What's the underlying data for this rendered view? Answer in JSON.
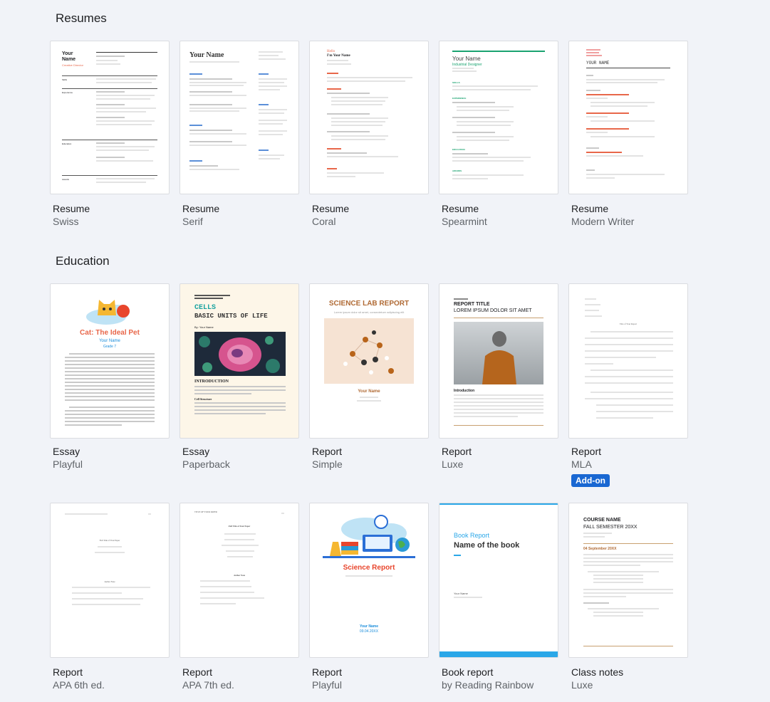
{
  "sections": {
    "resumes": "Resumes",
    "education": "Education"
  },
  "resumes": [
    {
      "title": "Resume",
      "subtitle": "Swiss"
    },
    {
      "title": "Resume",
      "subtitle": "Serif"
    },
    {
      "title": "Resume",
      "subtitle": "Coral"
    },
    {
      "title": "Resume",
      "subtitle": "Spearmint"
    },
    {
      "title": "Resume",
      "subtitle": "Modern Writer"
    }
  ],
  "education": [
    {
      "title": "Essay",
      "subtitle": "Playful"
    },
    {
      "title": "Essay",
      "subtitle": "Paperback"
    },
    {
      "title": "Report",
      "subtitle": "Simple"
    },
    {
      "title": "Report",
      "subtitle": "Luxe"
    },
    {
      "title": "Report",
      "subtitle": "MLA",
      "badge": "Add-on"
    },
    {
      "title": "Report",
      "subtitle": "APA 6th ed."
    },
    {
      "title": "Report",
      "subtitle": "APA 7th ed."
    },
    {
      "title": "Report",
      "subtitle": "Playful"
    },
    {
      "title": "Book report",
      "subtitle": "by Reading Rainbow"
    },
    {
      "title": "Class notes",
      "subtitle": "Luxe"
    }
  ],
  "previews": {
    "swiss": {
      "name1": "Your",
      "name2": "Name",
      "role": "Creative Director",
      "skills": "Skills",
      "experience": "Experience",
      "education": "Education",
      "awards": "Awards"
    },
    "serif": {
      "name": "Your Name"
    },
    "coral": {
      "hello": "Hello",
      "name": "I'm Your Name"
    },
    "spearmint": {
      "name": "Your Name",
      "role": "Industrial Designer",
      "skills": "SKILLS",
      "experience": "EXPERIENCE",
      "education": "EDUCATION",
      "awards": "AWARDS"
    },
    "modern": {
      "name": "YOUR NAME"
    },
    "playful_essay": {
      "title": "Cat: The Ideal Pet",
      "name": "Your Name",
      "grade": "Grade 7"
    },
    "paperback": {
      "title1": "CELLS",
      "title2": "BASIC UNITS OF LIFE",
      "by": "By: Your Name",
      "intro": "INTRODUCTION",
      "sub": "Cell Structure"
    },
    "simple": {
      "title": "SCIENCE LAB REPORT",
      "sub": "Lorem ipsum dolor sit amet, consectetuer adipiscing elit",
      "name": "Your Name"
    },
    "luxe": {
      "title1": "REPORT TITLE",
      "title2": "LOREM IPSUM DOLOR SIT AMET",
      "intro": "Introduction"
    },
    "mla": {
      "title": "Title of Your Report"
    },
    "apa6": {
      "title": "Full Title of Your Paper",
      "author": "Author Note"
    },
    "apa7": {
      "head": "TITLE OF YOUR PAPER",
      "title": "Full Title of Your Paper",
      "author": "Author Note"
    },
    "playful_report": {
      "title": "Science Report",
      "name": "Your Name",
      "date": "09.04.20XX"
    },
    "book": {
      "label": "Book Report",
      "title": "Name of the book",
      "name": "Your Name"
    },
    "notes": {
      "course": "COURSE NAME",
      "sem": "FALL SEMESTER 20XX",
      "date": "04 September 20XX"
    }
  },
  "colors": {
    "coral": "#e8674a",
    "spearmint": "#1aa370",
    "badge": "#1967d2",
    "book_blue": "#2aa7e8",
    "luxe_brown": "#b06a34"
  }
}
